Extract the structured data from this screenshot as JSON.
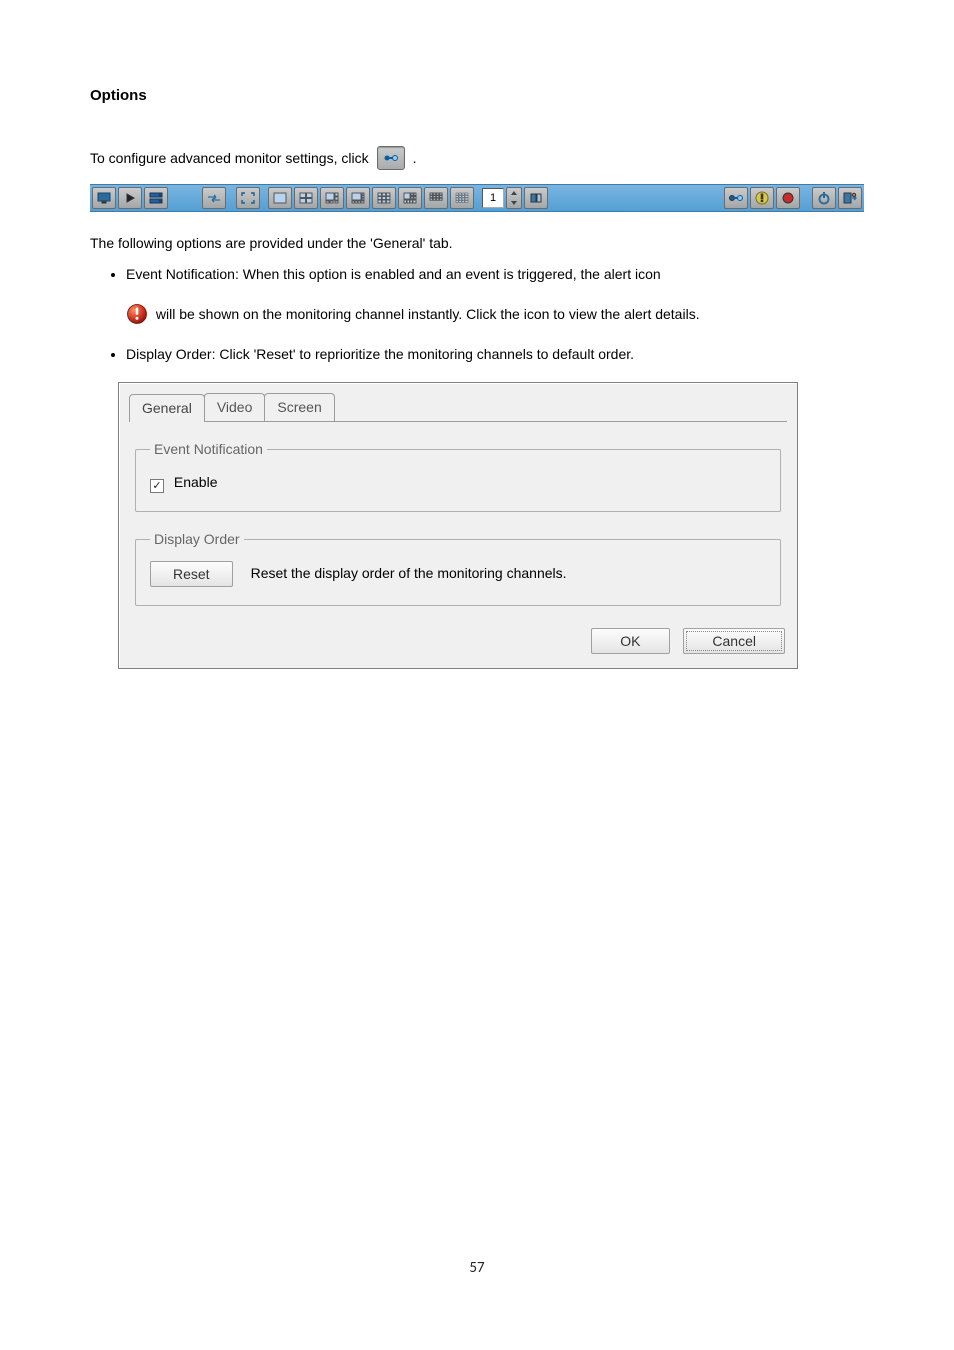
{
  "heading": "Options",
  "intro_part1": "To configure advanced monitor settings, click ",
  "intro_part2": ".",
  "toolbar": {
    "page": "1"
  },
  "body1": "The following options are provided under the 'General' tab.",
  "bullets": {
    "b1": "Event Notification: When this option is enabled and an event is triggered, the alert icon",
    "b1_cont": " will be shown on the monitoring channel instantly.    Click the icon to view the alert details.",
    "b2": "Display Order: Click 'Reset' to reprioritize the monitoring channels to default order."
  },
  "dialog": {
    "tabs": {
      "general": "General",
      "video": "Video",
      "screen": "Screen"
    },
    "grp1": {
      "legend": "Event Notification",
      "enable": "Enable"
    },
    "grp2": {
      "legend": "Display Order",
      "reset": "Reset",
      "desc": "Reset the display order of the monitoring channels."
    },
    "ok": "OK",
    "cancel": "Cancel"
  },
  "pagenum": "57"
}
